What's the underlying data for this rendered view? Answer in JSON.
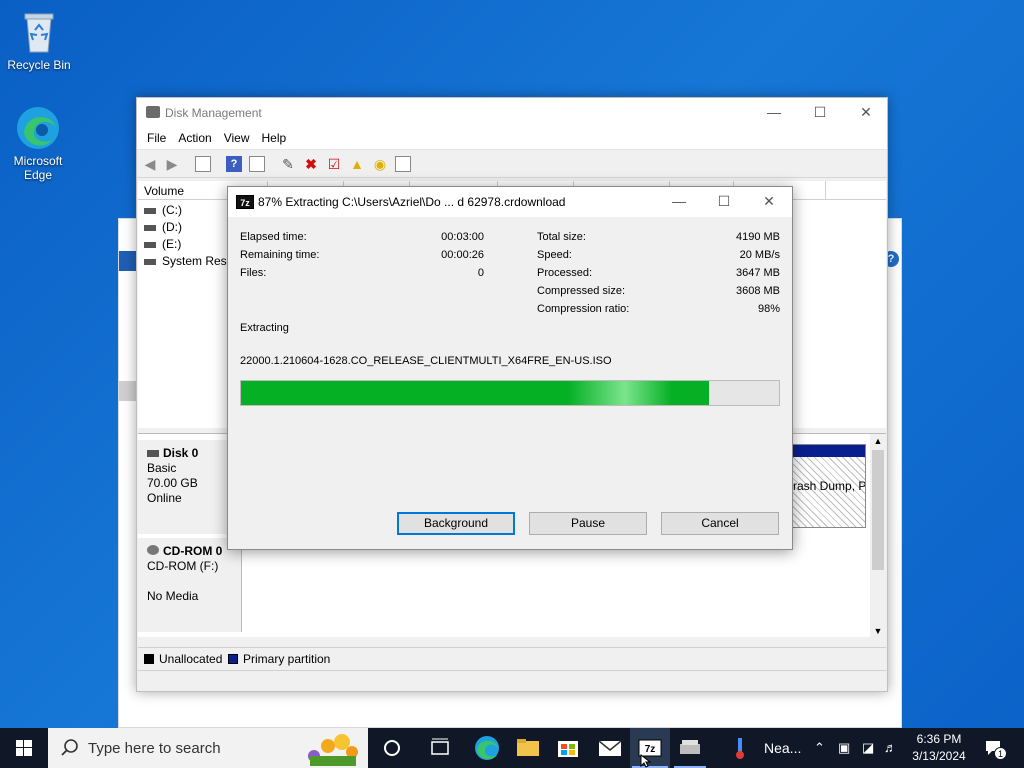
{
  "desktop": {
    "icons": [
      {
        "label": "Recycle Bin",
        "icon": "recycle-bin-icon"
      },
      {
        "label": "Microsoft Edge",
        "icon": "edge-icon"
      }
    ]
  },
  "disk_management": {
    "title": "Disk Management",
    "menu": [
      "File",
      "Action",
      "View",
      "Help"
    ],
    "columns": {
      "volume": "Volume"
    },
    "volumes": [
      "(C:)",
      "(D:)",
      "(E:)",
      "System Reser"
    ],
    "disks": [
      {
        "name": "Disk 0",
        "type": "Basic",
        "size": "70.00 GB",
        "status": "Online"
      },
      {
        "name": "CD-ROM 0",
        "type": "CD-ROM (F:)",
        "size": "",
        "status": "No Media"
      }
    ],
    "partition_text": "rash Dump, P",
    "legend": [
      "Unallocated",
      "Primary partition"
    ]
  },
  "extract_dialog": {
    "title": "87% Extracting C:\\Users\\Azriel\\Do ... d 62978.crdownload",
    "progress_percent": 87,
    "left_stats": [
      {
        "label": "Elapsed time:",
        "value": "00:03:00"
      },
      {
        "label": "Remaining time:",
        "value": "00:00:26"
      },
      {
        "label": "Files:",
        "value": "0"
      }
    ],
    "right_stats": [
      {
        "label": "Total size:",
        "value": "4190 MB"
      },
      {
        "label": "Speed:",
        "value": "20 MB/s"
      },
      {
        "label": "Processed:",
        "value": "3647 MB"
      },
      {
        "label": "Compressed size:",
        "value": "3608 MB"
      },
      {
        "label": "Compression ratio:",
        "value": "98%"
      }
    ],
    "status": "Extracting",
    "current_file": "22000.1.210604-1628.CO_RELEASE_CLIENTMULTI_X64FRE_EN-US.ISO",
    "buttons": {
      "background": "Background",
      "pause": "Pause",
      "cancel": "Cancel"
    }
  },
  "taskbar": {
    "search_placeholder": "Type here to search",
    "weather_text": "Nea...",
    "time": "6:36 PM",
    "date": "3/13/2024",
    "notification_count": "1"
  }
}
